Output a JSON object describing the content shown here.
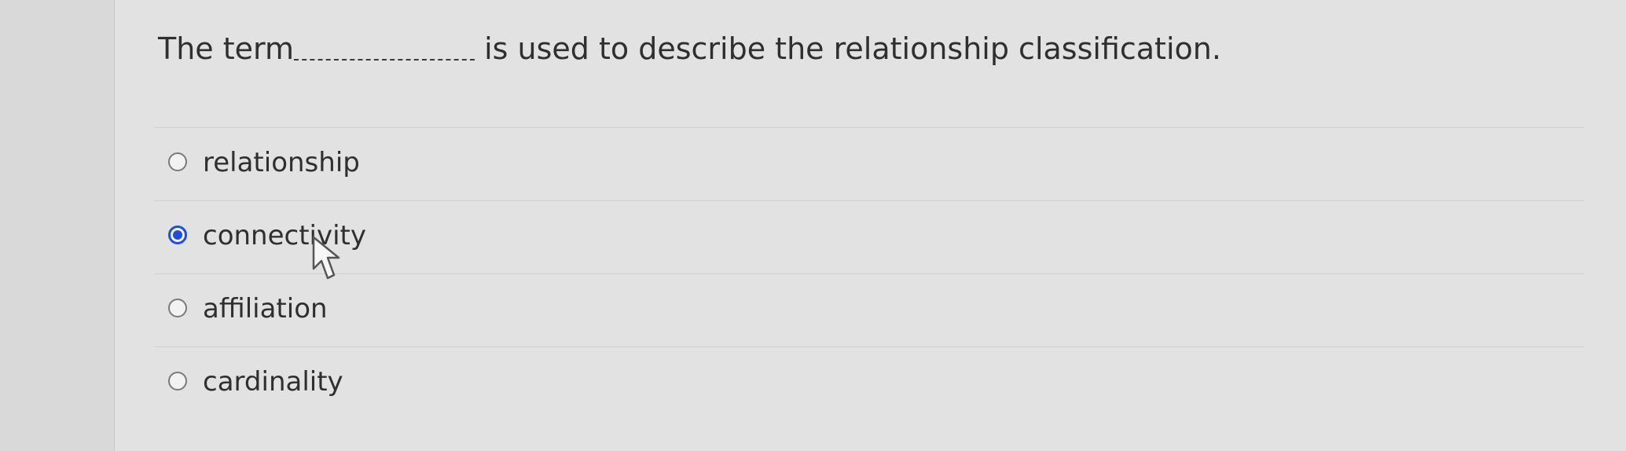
{
  "question": {
    "prefix": "The term",
    "suffix": " is used to describe the relationship classification."
  },
  "answers": [
    {
      "label": "relationship",
      "selected": false
    },
    {
      "label": "connectivity",
      "selected": true
    },
    {
      "label": "affiliation",
      "selected": false
    },
    {
      "label": "cardinality",
      "selected": false
    }
  ],
  "colors": {
    "background": "#e2e2e2",
    "selected_radio": "#1f4fd6",
    "text": "#2f2f2f"
  },
  "icons": {
    "cursor": "arrow-cursor-icon"
  }
}
